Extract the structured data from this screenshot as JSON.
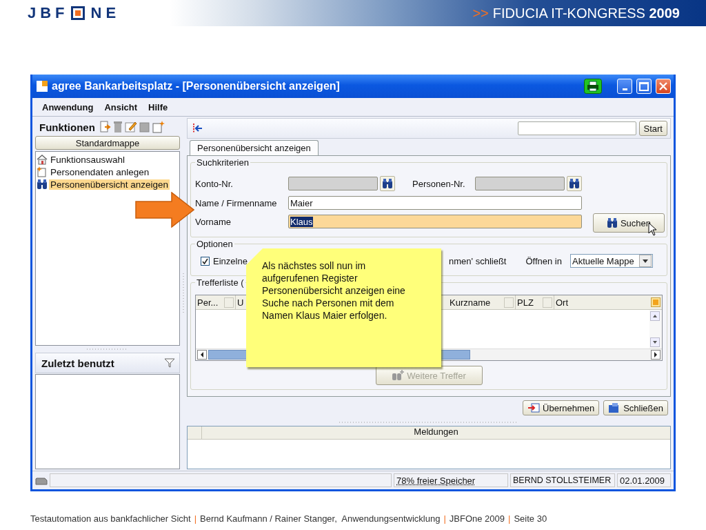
{
  "slide_header": {
    "logo_left": "JBF",
    "logo_right": "NE",
    "prefix": ">>",
    "title": "FIDUCIA IT-KONGRESS **2009**"
  },
  "window": {
    "title": "agree Bankarbeitsplatz - [Personenübersicht anzeigen]"
  },
  "menu": [
    "Anwendung",
    "Ansicht",
    "Hilfe"
  ],
  "functions_panel": {
    "title": "Funktionen",
    "folder_button": "Standardmappe",
    "items": [
      {
        "label": "Funktionsauswahl",
        "kind": "house",
        "selected": false
      },
      {
        "label": "Personendaten anlegen",
        "kind": "new",
        "selected": false
      },
      {
        "label": "Personenübersicht anzeigen",
        "kind": "binoculars",
        "selected": true
      }
    ]
  },
  "recent_panel": {
    "title": "Zuletzt benutzt"
  },
  "toolbar": {
    "start_button": "Start"
  },
  "tabs": [
    {
      "label": "Personenübersicht anzeigen",
      "selected": true
    }
  ],
  "search_criteria": {
    "title": "Suchkriterien",
    "account": {
      "label": "Konto-Nr.",
      "disabled": true
    },
    "person_no": {
      "label": "Personen-Nr.",
      "disabled": true
    },
    "name": {
      "label": "Name / Firmenname",
      "value": "Maier",
      "focused": false
    },
    "first_name": {
      "label": "Vorname",
      "value": "Klaus",
      "focused": true
    },
    "search_button": "Suchen"
  },
  "options": {
    "title": "Optionen",
    "checkbox": {
      "label_start": "Einzelne",
      "label_end": "nmen' schließt",
      "checked": true
    },
    "open_in_label": "Öffnen in",
    "open_in_value": "Aktuelle Mappe"
  },
  "results": {
    "title": "Trefferliste (",
    "columns": [
      "Per...",
      "U",
      "Kurzname",
      "PLZ",
      "Ort"
    ],
    "more_button": {
      "label": "Weitere Treffer",
      "disabled": true
    }
  },
  "actions": [
    "Übernehmen",
    "Schließen"
  ],
  "messages": {
    "title": "Meldungen"
  },
  "status_bar": {
    "memory": "78% freier Speicher",
    "user": "BERND STOLLSTEIMER",
    "date": "02.01.2009"
  },
  "callout": {
    "text": "Als nächstes soll nun im aufgerufenen Register Personenübersicht anzeigen eine Suche nach Personen mit dem Namen Klaus Maier erfolgen."
  },
  "footer": [
    {
      "kind": "text",
      "text": "Testautomation aus bankfachlicher Sicht"
    },
    {
      "kind": "separator",
      "text": "|"
    },
    {
      "kind": "text",
      "text": "Bernd Kaufmann / Rainer Stanger,  Anwendungsentwicklung"
    },
    {
      "kind": "separator",
      "text": "|"
    },
    {
      "kind": "text",
      "text": "JBFOne 2009"
    },
    {
      "kind": "separator",
      "text": "|"
    },
    {
      "kind": "text",
      "text": "Seite 30"
    }
  ]
}
